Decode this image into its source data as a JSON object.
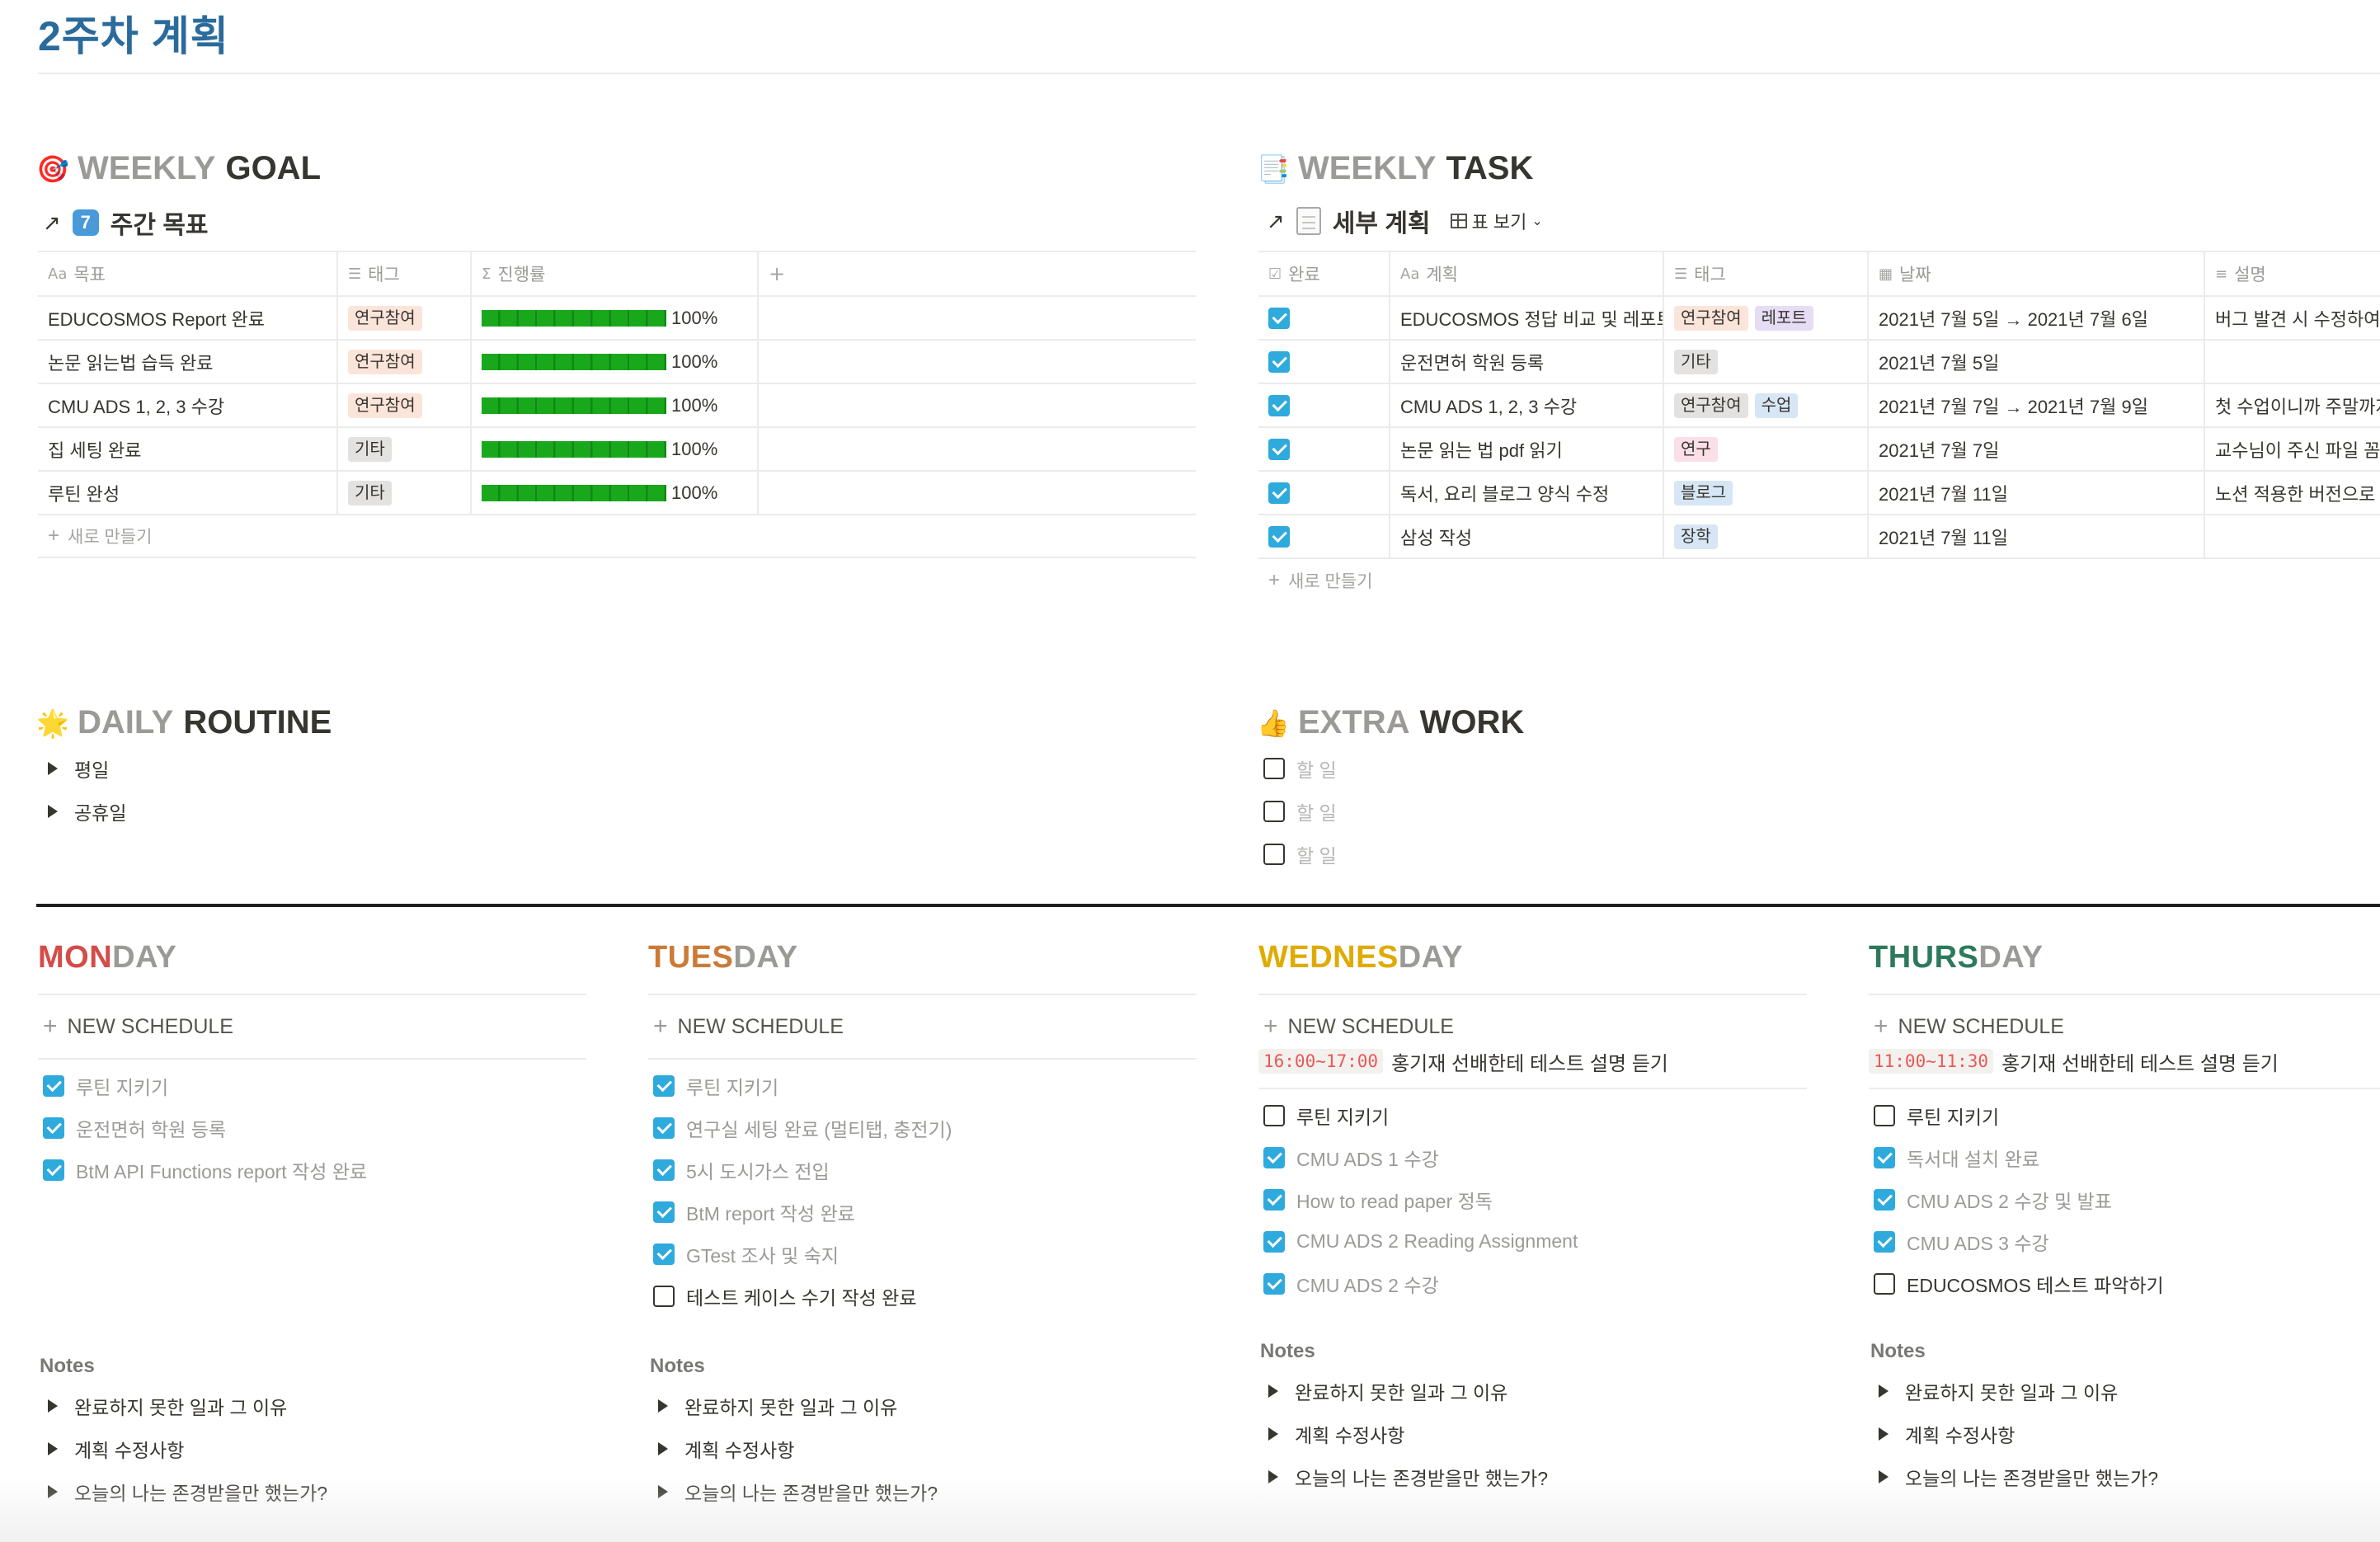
{
  "page": {
    "title": "2주차 계획"
  },
  "weekly_goal": {
    "heading_gray": "WEEKLY",
    "heading_dark": "GOAL",
    "emoji": "🎯",
    "linked_arrow": "↗",
    "badge": "7",
    "db_title": "주간 목표",
    "columns": [
      "목표",
      "태그",
      "진행률"
    ],
    "column_icons": [
      "Aa",
      "☰",
      "Σ"
    ],
    "add_column": "+",
    "rows": [
      {
        "goal": "EDUCOSMOS Report 완료",
        "tag": "연구참여",
        "tag_class": "t-research",
        "progress": 1.0,
        "progress_label": "100%"
      },
      {
        "goal": "논문 읽는법 습득 완료",
        "tag": "연구참여",
        "tag_class": "t-research",
        "progress": 1.0,
        "progress_label": "100%"
      },
      {
        "goal": "CMU ADS 1, 2, 3 수강",
        "tag": "연구참여",
        "tag_class": "t-research",
        "progress": 1.0,
        "progress_label": "100%"
      },
      {
        "goal": "집 세팅 완료",
        "tag": "기타",
        "tag_class": "t-other",
        "progress": 1.0,
        "progress_label": "100%"
      },
      {
        "goal": "루틴 완성",
        "tag": "기타",
        "tag_class": "t-other",
        "progress": 1.0,
        "progress_label": "100%"
      }
    ],
    "new_row": "새로 만들기"
  },
  "weekly_task": {
    "heading_gray": "WEEKLY",
    "heading_dark": "TASK",
    "emoji": "📑",
    "linked_arrow": "↗",
    "db_title": "세부 계획",
    "view_label": "표 보기",
    "columns": [
      "완료",
      "계획",
      "태그",
      "날짜",
      "설명"
    ],
    "column_icons": [
      "☑",
      "Aa",
      "☰",
      "▦",
      "≡"
    ],
    "rows": [
      {
        "done": true,
        "plan": "EDUCOSMOS 정답 비교 및 레포트",
        "tags": [
          {
            "label": "연구참여",
            "cls": "t-research"
          },
          {
            "label": "레포트",
            "cls": "t-report"
          }
        ],
        "date": "2021년 7월 5일 → 2021년 7월 6일",
        "desc": "버그 발견 시 수정하여"
      },
      {
        "done": true,
        "plan": "운전면허 학원 등록",
        "tags": [
          {
            "label": "기타",
            "cls": "t-other"
          }
        ],
        "date": "2021년 7월 5일",
        "desc": ""
      },
      {
        "done": true,
        "plan": "CMU ADS 1, 2, 3 수강",
        "tags": [
          {
            "label": "연구참여",
            "cls": "t-other"
          },
          {
            "label": "수업",
            "cls": "t-class"
          }
        ],
        "date": "2021년 7월 7일 → 2021년 7월 9일",
        "desc": "첫 수업이니까 주말까지"
      },
      {
        "done": true,
        "plan": "논문 읽는 법 pdf 읽기",
        "tags": [
          {
            "label": "연구",
            "cls": "t-yeongu"
          }
        ],
        "date": "2021년 7월 7일",
        "desc": "교수님이 주신 파일 꼼꼼"
      },
      {
        "done": true,
        "plan": "독서, 요리 블로그 양식 수정",
        "tags": [
          {
            "label": "블로그",
            "cls": "t-blog"
          }
        ],
        "date": "2021년 7월 11일",
        "desc": "노션 적용한 버전으로 양"
      },
      {
        "done": true,
        "plan": "삼성 작성",
        "tags": [
          {
            "label": "장학",
            "cls": "t-scholar"
          }
        ],
        "date": "2021년 7월 11일",
        "desc": ""
      }
    ],
    "new_row": "새로 만들기"
  },
  "daily_routine": {
    "heading_gray": "DAILY",
    "heading_dark": "ROUTINE",
    "emoji": "🌟",
    "toggles": [
      "평일",
      "공휴일"
    ]
  },
  "extra_work": {
    "heading_gray": "EXTRA",
    "heading_dark": "WORK",
    "emoji": "👍",
    "todos": [
      "할 일",
      "할 일",
      "할 일"
    ]
  },
  "days": [
    {
      "prefix": "MON",
      "suffix": "DAY",
      "color": "#d44c47",
      "new_schedule": "NEW SCHEDULE",
      "schedule": null,
      "todos": [
        {
          "text": "루틴 지키기",
          "done": true
        },
        {
          "text": "운전면허 학원 등록",
          "done": true
        },
        {
          "text": "BtM API Functions report 작성 완료",
          "done": true
        }
      ],
      "notes_label": "Notes",
      "notes": [
        "완료하지 못한 일과 그 이유",
        "계획 수정사항",
        "오늘의 나는 존경받을만 했는가?"
      ]
    },
    {
      "prefix": "TUES",
      "suffix": "DAY",
      "color": "#cb7b37",
      "new_schedule": "NEW SCHEDULE",
      "schedule": null,
      "todos": [
        {
          "text": "루틴 지키기",
          "done": true
        },
        {
          "text": "연구실 세팅 완료 (멀티탭, 충전기)",
          "done": true
        },
        {
          "text": "5시 도시가스 전입",
          "done": true
        },
        {
          "text": "BtM report 작성 완료",
          "done": true
        },
        {
          "text": "GTest 조사 및 숙지",
          "done": true
        },
        {
          "text": "테스트 케이스 수기 작성 완료",
          "done": false
        }
      ],
      "notes_label": "Notes",
      "notes": [
        "완료하지 못한 일과 그 이유",
        "계획 수정사항",
        "오늘의 나는 존경받을만 했는가?"
      ]
    },
    {
      "prefix": "WEDNES",
      "suffix": "DAY",
      "color": "#dfab01",
      "new_schedule": "NEW SCHEDULE",
      "schedule": {
        "time": "16:00~17:00",
        "text": "홍기재 선배한테 테스트 설명 듣기"
      },
      "todos": [
        {
          "text": "루틴 지키기",
          "done": false
        },
        {
          "text": "CMU ADS 1 수강",
          "done": true
        },
        {
          "text": "How to read paper 정독",
          "done": true
        },
        {
          "text": "CMU ADS 2 Reading Assignment",
          "done": true
        },
        {
          "text": "CMU ADS 2 수강",
          "done": true
        }
      ],
      "notes_label": "Notes",
      "notes": [
        "완료하지 못한 일과 그 이유",
        "계획 수정사항",
        "오늘의 나는 존경받을만 했는가?"
      ]
    },
    {
      "prefix": "THURS",
      "suffix": "DAY",
      "color": "#2c7a5b",
      "new_schedule": "NEW SCHEDULE",
      "schedule": {
        "time": "11:00~11:30",
        "text": "홍기재 선배한테 테스트 설명 듣기"
      },
      "todos": [
        {
          "text": "루틴 지키기",
          "done": false
        },
        {
          "text": "독서대 설치 완료",
          "done": true
        },
        {
          "text": "CMU ADS 2 수강 및 발표",
          "done": true
        },
        {
          "text": "CMU ADS 3 수강",
          "done": true
        },
        {
          "text": "EDUCOSMOS 테스트 파악하기",
          "done": false
        }
      ],
      "notes_label": "Notes",
      "notes": [
        "완료하지 못한 일과 그 이유",
        "계획 수정사항",
        "오늘의 나는 존경받을만 했는가?"
      ]
    }
  ],
  "colors": {
    "title": "#2a6b9c",
    "checkbox_on": "#2eaadc",
    "progress_fill": "#19a81c",
    "time_text": "#eb5757"
  }
}
